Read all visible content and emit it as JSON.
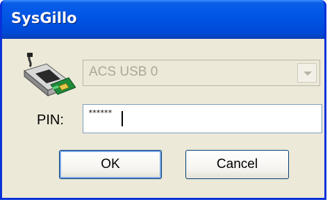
{
  "window": {
    "title": "SysGillo"
  },
  "reader": {
    "selected": "ACS USB 0"
  },
  "pin": {
    "label": "PIN:",
    "value": "******"
  },
  "buttons": {
    "ok": "OK",
    "cancel": "Cancel"
  },
  "colors": {
    "titlebar": "#0055e5",
    "client": "#ece9d8",
    "button_border": "#003c74"
  },
  "icons": {
    "reader": "smartcard-reader-icon",
    "dropdown": "chevron-down-icon"
  }
}
